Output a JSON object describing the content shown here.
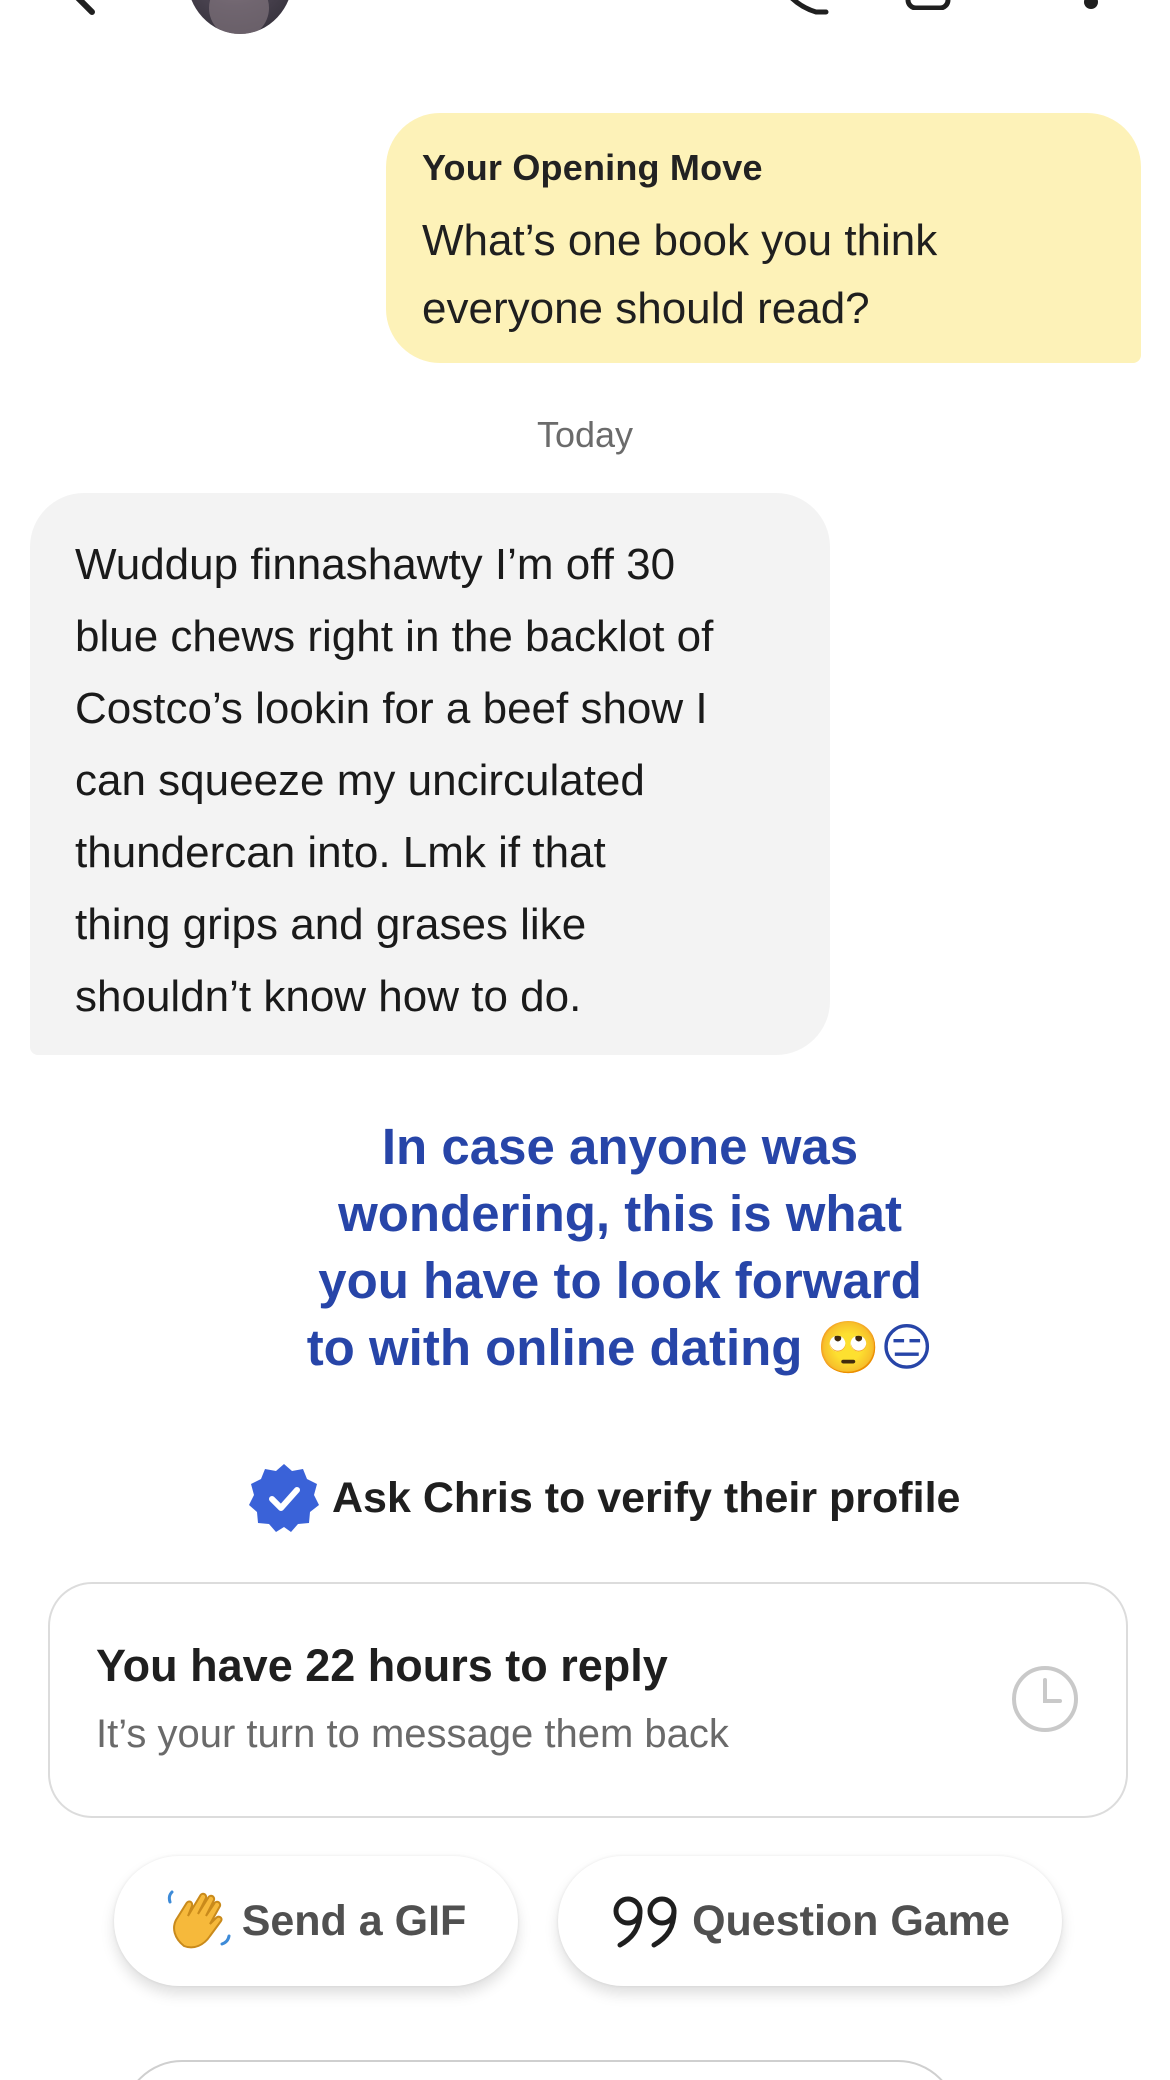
{
  "header": {
    "back_icon": "chevron-left-icon",
    "call_icon": "phone-icon",
    "video_icon": "video-camera-icon",
    "more_icon": "more-vertical-icon"
  },
  "opening_move": {
    "title": "Your Opening Move",
    "text_lines": [
      "What’s one book you think",
      "everyone should read?"
    ],
    "color": "#fdf2b8"
  },
  "date_separator": "Today",
  "received_message": {
    "lines": [
      "Wuddup finnashawty I’m off 30",
      "blue chews right in the backlot of",
      "Costco’s lookin for a beef show I",
      "can squeeze my uncirculated",
      "thundercan into. Lmk if that",
      "thing grips and grases like",
      "shouldn’t know how to do."
    ]
  },
  "caption": {
    "lines": [
      "In case anyone was",
      "wondering, this is what",
      "you have to look forward",
      "to with online dating 🙄😑"
    ],
    "color": "#2745a8"
  },
  "verify": {
    "icon": "verified-badge-icon",
    "label": "Ask Chris to verify their profile",
    "color": "#3a62d8"
  },
  "reply_card": {
    "title": "You have 22 hours to reply",
    "subtitle": "It’s your turn to message them back",
    "icon": "clock-icon"
  },
  "quick_actions": [
    {
      "icon": "waving-hand-icon",
      "label": "Send a GIF"
    },
    {
      "icon": "quote-icon",
      "label": "Question Game"
    }
  ]
}
